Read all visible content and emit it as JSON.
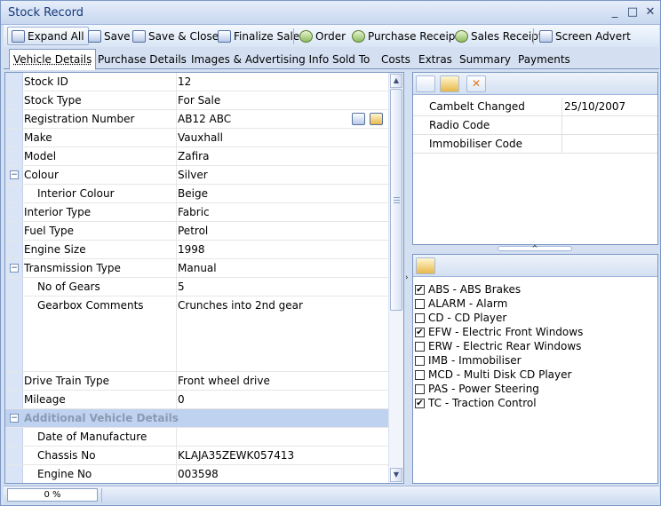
{
  "window": {
    "title": "Stock Record"
  },
  "toolbar": {
    "expand_all": "Expand All",
    "save": "Save",
    "save_close": "Save & Close",
    "finalize_sale": "Finalize Sale",
    "order": "Order",
    "purchase_receipt": "Purchase Receipt",
    "sales_receipt": "Sales Receipt",
    "screen_advert": "Screen Advert"
  },
  "tabs": [
    "Vehicle Details",
    "Purchase Details",
    "Images & Advertising Info",
    "Sold To",
    "Costs",
    "Extras",
    "Summary",
    "Payments"
  ],
  "properties": [
    {
      "label": "Stock ID",
      "value": "12"
    },
    {
      "label": "Stock Type",
      "value": "For Sale"
    },
    {
      "label": "Registration Number",
      "value": "AB12 ABC"
    },
    {
      "label": "Make",
      "value": "Vauxhall"
    },
    {
      "label": "Model",
      "value": "Zafira"
    },
    {
      "label": "Colour",
      "value": "Silver"
    },
    {
      "label": "Interior Colour",
      "value": "Beige"
    },
    {
      "label": "Interior Type",
      "value": "Fabric"
    },
    {
      "label": "Fuel Type",
      "value": "Petrol"
    },
    {
      "label": "Engine Size",
      "value": "1998"
    },
    {
      "label": "Transmission Type",
      "value": "Manual"
    },
    {
      "label": "No of Gears",
      "value": "5"
    },
    {
      "label": "Gearbox Comments",
      "value": "Crunches into 2nd gear"
    },
    {
      "label": "Drive Train Type",
      "value": "Front wheel drive"
    },
    {
      "label": "Mileage",
      "value": "0"
    },
    {
      "label": "Additional Vehicle Details",
      "value": ""
    },
    {
      "label": "Date of Manufacture",
      "value": ""
    },
    {
      "label": "Chassis No",
      "value": "KLAJA35ZEWK057413"
    },
    {
      "label": "Engine No",
      "value": "003598"
    }
  ],
  "expanders": {
    "colour": "−",
    "transmission": "−",
    "additional": "−"
  },
  "service": [
    {
      "label": "Cambelt Changed",
      "value": "25/10/2007"
    },
    {
      "label": "Radio Code",
      "value": ""
    },
    {
      "label": "Immobiliser Code",
      "value": ""
    }
  ],
  "features": [
    {
      "label": "ABS - ABS Brakes",
      "checked": true
    },
    {
      "label": "ALARM - Alarm",
      "checked": false
    },
    {
      "label": "CD - CD Player",
      "checked": false
    },
    {
      "label": "EFW - Electric Front Windows",
      "checked": true
    },
    {
      "label": "ERW - Electric Rear Windows",
      "checked": false
    },
    {
      "label": "IMB - Immobiliser",
      "checked": false
    },
    {
      "label": "MCD - Multi Disk CD Player",
      "checked": false
    },
    {
      "label": "PAS - Power Steering",
      "checked": false
    },
    {
      "label": "TC - Traction Control",
      "checked": true
    }
  ],
  "check_mark": "✔",
  "status": {
    "progress_text": "0 %",
    "progress": 0
  }
}
